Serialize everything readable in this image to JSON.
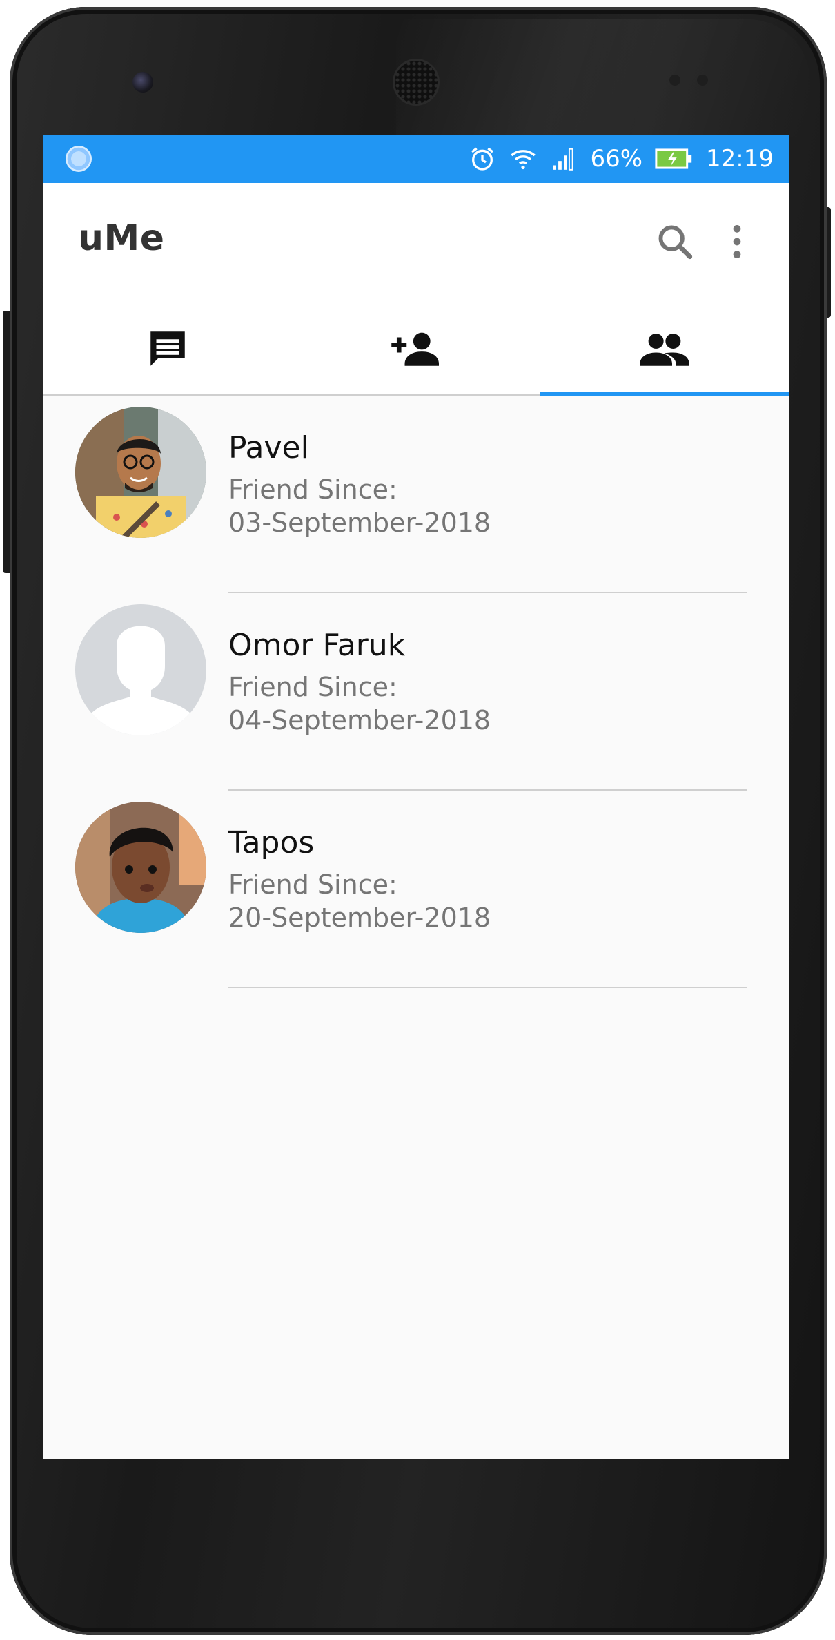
{
  "status_bar": {
    "battery_percent": "66%",
    "time": "12:19",
    "icons": [
      "loading-icon",
      "alarm-icon",
      "wifi-icon",
      "signal-icon",
      "battery-charging-icon"
    ]
  },
  "app_bar": {
    "title": "uMe",
    "actions": [
      "search-icon",
      "more-vert-icon"
    ]
  },
  "tabs": [
    {
      "icon": "chat-icon",
      "selected": false
    },
    {
      "icon": "person-add-icon",
      "selected": false
    },
    {
      "icon": "people-icon",
      "selected": true
    }
  ],
  "colors": {
    "accent": "#2196f3",
    "text_primary": "#111111",
    "text_secondary": "#757575",
    "background": "#fafafa"
  },
  "friends": [
    {
      "name": "Pavel",
      "label": "Friend Since:",
      "date": "03-September-2018",
      "avatar": "photo"
    },
    {
      "name": "Omor Faruk",
      "label": "Friend Since:",
      "date": "04-September-2018",
      "avatar": "default-silhouette"
    },
    {
      "name": "Tapos",
      "label": "Friend Since:",
      "date": "20-September-2018",
      "avatar": "photo"
    }
  ]
}
